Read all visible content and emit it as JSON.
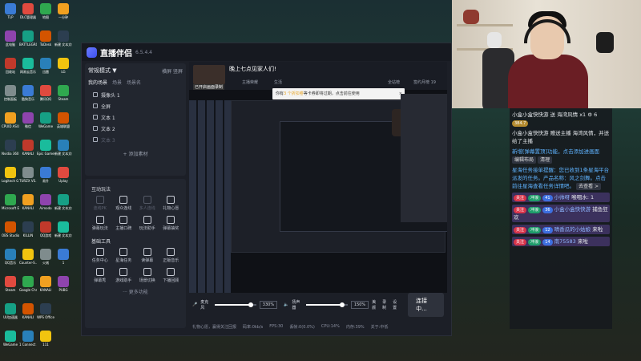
{
  "desktop": {
    "icons": [
      [
        "TLP",
        "DLC管理器",
        "地图",
        "一分钟"
      ],
      [
        "此电脑",
        "BATTLEGRO..",
        "ToDesk",
        "新建 文本文档"
      ],
      [
        "回收站",
        "网易云音乐",
        "迅雷",
        "LG"
      ],
      [
        "控制面板",
        "酷狗音乐",
        "腾讯QQ",
        "Steam"
      ],
      [
        "CPUID ASUS CPU-Z",
        "微信",
        "WeGame",
        "英雄联盟"
      ],
      [
        "Nvidia 360 Link Co..",
        "KANALI",
        "Epic Games Launcher",
        "新建 文本文档"
      ],
      [
        "Logitech G HUB",
        "TURZX VS..",
        "易升",
        "Uplay"
      ],
      [
        "Microsoft Edge",
        "KANALI",
        "Aimodo",
        "新建 文本文档"
      ],
      [
        "OBS Studio",
        "KILLIN",
        "QQ游戏",
        "新建 文本文档"
      ],
      [
        "QQ音乐",
        "Counter-S..",
        "火绒",
        "1"
      ],
      [
        "Steam",
        "Google Chrome",
        "KANALI",
        "PUBG"
      ],
      [
        "UU加速器",
        "KANALI",
        "WPS Office",
        ""
      ],
      [
        "WeGame",
        "1 Connect 3",
        "111",
        ""
      ]
    ]
  },
  "app": {
    "title": "直播伴侣",
    "version": "6.5.4.4",
    "mode": "常规模式 ▼",
    "orientation": "横屏  竖屏",
    "scene_tabs": [
      "我的场景",
      "场景",
      "场景名"
    ],
    "sources": [
      {
        "label": "摄像头 1",
        "dim": false
      },
      {
        "label": "全屏",
        "dim": false
      },
      {
        "label": "文本 1",
        "dim": false
      },
      {
        "label": "文本 2",
        "dim": false
      },
      {
        "label": "文本 3",
        "dim": true
      }
    ],
    "add_source": "+ 添加素材",
    "interactive_title": "互动玩法",
    "interactive_tools": [
      {
        "label": "连线PK",
        "dim": true
      },
      {
        "label": "观众连线",
        "dim": false
      },
      {
        "label": "多人连线",
        "dim": true
      },
      {
        "label": "礼物心愿",
        "dim": false
      },
      {
        "label": "弹幕玩法",
        "dim": false
      },
      {
        "label": "主播口碑",
        "dim": false
      },
      {
        "label": "玩法助手",
        "dim": false
      },
      {
        "label": "弹幕抽奖",
        "dim": false
      }
    ],
    "basic_title": "基础工具",
    "basic_tools": [
      {
        "label": "任务中心"
      },
      {
        "label": "星海任务"
      },
      {
        "label": "读弹幕"
      },
      {
        "label": "正版音乐"
      },
      {
        "label": "弹幕秀"
      },
      {
        "label": "游戏助手"
      },
      {
        "label": "场景切换"
      },
      {
        "label": "下播回顾"
      }
    ],
    "more_tools": "··· 更多功能",
    "preview": {
      "user_name": "晚上七点见家人们!",
      "status_label": "已开启画面录制",
      "tabs": [
        "主播荣耀",
        "生活",
        "全站榜",
        "签约月榜 19"
      ],
      "notice_prefix": "你有",
      "notice_highlight": "3 个折扣卷",
      "notice_suffix": "等卡券即将过期，点击前往使用"
    },
    "bottom": {
      "mic_label": "麦克风",
      "mic_value": "330%",
      "mic_level": 0.78,
      "speaker_label": "扬声器",
      "speaker_value": "150%",
      "speaker_level": 0.78,
      "effects_label": "美颜",
      "record_label": "录制",
      "settings_label": "设置",
      "go_live": "连接中..."
    },
    "status": [
      "礼物心愿，赢得关注回报",
      "码率:0kb/s",
      "FPS:30",
      "丢帧:0(0.0%)",
      "CPU:14%",
      "内存:39%",
      "关于:中低"
    ]
  },
  "chat": {
    "lines": [
      {
        "type": "gift",
        "text": "小盒小盒快快游 送 海湾风情 x1 ⚙ 6",
        "extra": "384.7"
      },
      {
        "type": "plain",
        "text": "小盒小盒快快游 赠送主播 海湾风情，并送给了主播"
      },
      {
        "type": "system",
        "text": "新增[弹幕置顶]功能，点击添加进画面",
        "btn1": "编辑布局",
        "btn2": "清理"
      },
      {
        "type": "system",
        "text": "星海任务接单提醒：您已收到1条星海平台派发的任务。产品名称：风之剑舞。点击前往星海查看任务详情吧。",
        "btn1": "去查看 >"
      },
      {
        "type": "user",
        "badge1": "关注",
        "badge2": "冲浪",
        "level": "41",
        "name": "小帅呀",
        "text": "喉咽水: 1"
      },
      {
        "type": "user",
        "badge1": "关注",
        "badge2": "冲浪",
        "level": "36",
        "name": "小盒小盒快快游",
        "text": "捕鱼狂欢"
      },
      {
        "type": "user",
        "badge1": "关注",
        "badge2": "冲浪",
        "level": "12",
        "name": "晴香瓜的小姑娘",
        "text": "来啦"
      },
      {
        "type": "user",
        "badge1": "关注",
        "badge2": "冲浪",
        "level": "14",
        "name": "南75583",
        "text": "来啦"
      }
    ]
  },
  "colors": {
    "accent": "#4c5bf0",
    "badge_red": "#d9354a",
    "badge_green": "#1e9e6a",
    "badge_blue": "#3d6fe0"
  }
}
